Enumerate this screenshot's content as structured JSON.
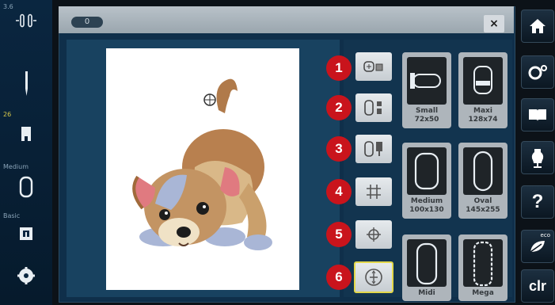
{
  "left_sidebar": {
    "speed_value": "3.6",
    "stitch_number": "26",
    "hoop_label": "Medium",
    "stitch_label": "Basic"
  },
  "title": {
    "tab_label": "0",
    "close_symbol": "×"
  },
  "tools": [
    {
      "number": "1",
      "icon": "hoop-view-icon"
    },
    {
      "number": "2",
      "icon": "hoop-select-icon"
    },
    {
      "number": "3",
      "icon": "hoop-attach-icon"
    },
    {
      "number": "4",
      "icon": "grid-icon"
    },
    {
      "number": "5",
      "icon": "center-cross-icon"
    },
    {
      "number": "6",
      "icon": "centering-icon"
    }
  ],
  "hoops": [
    {
      "name": "Small",
      "size": "72x50"
    },
    {
      "name": "Maxi",
      "size": "128x74"
    },
    {
      "name": "Medium",
      "size": "100x130"
    },
    {
      "name": "Oval",
      "size": "145x255"
    },
    {
      "name": "Midi",
      "size": ""
    },
    {
      "name": "Mega",
      "size": ""
    }
  ],
  "right_sidebar": {
    "home": "home-icon",
    "settings": "settings-icon",
    "tutorial": "book-icon",
    "consultant": "dress-form-icon",
    "help_label": "?",
    "eco_label": "eco",
    "clr_label": "clr"
  }
}
